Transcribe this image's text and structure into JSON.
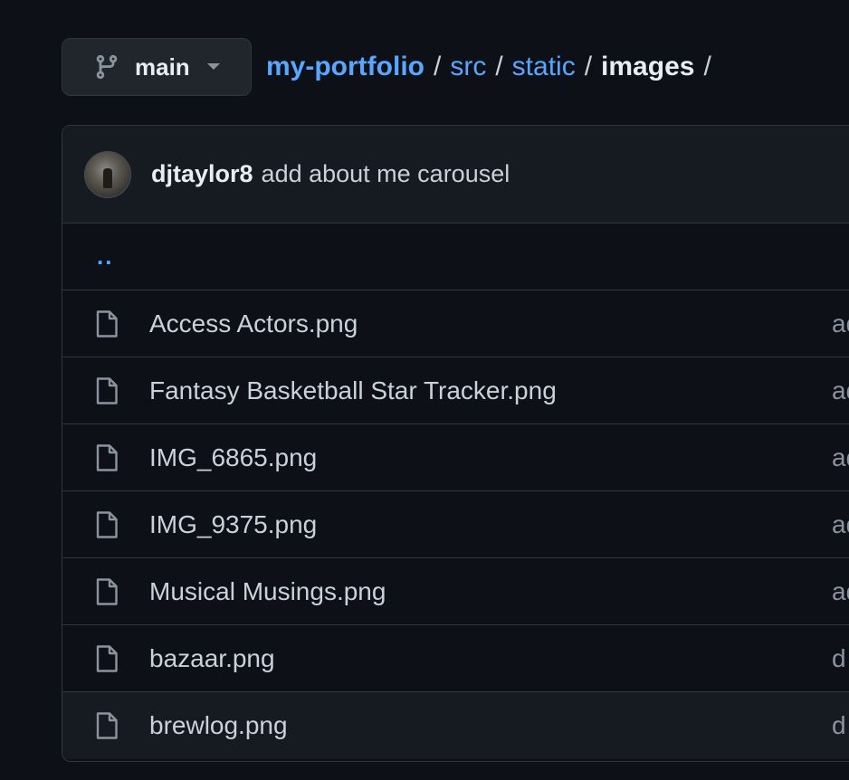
{
  "branch": {
    "name": "main",
    "icon": "git-branch-icon",
    "caret_icon": "caret-down-icon"
  },
  "breadcrumb": {
    "repo": "my-portfolio",
    "separator": "/",
    "segments": [
      "src",
      "static"
    ],
    "current": "images",
    "trailing": "/"
  },
  "latest_commit": {
    "author": "djtaylor8",
    "message": "add about me carousel"
  },
  "parent_link": "..",
  "files": [
    {
      "name": "Access Actors.png",
      "commit": "add"
    },
    {
      "name": "Fantasy Basketball Star Tracker.png",
      "commit": "add"
    },
    {
      "name": "IMG_6865.png",
      "commit": "add"
    },
    {
      "name": "IMG_9375.png",
      "commit": "add"
    },
    {
      "name": "Musical Musings.png",
      "commit": "add"
    },
    {
      "name": "bazaar.png",
      "commit": "d"
    },
    {
      "name": "brewlog.png",
      "commit": "d"
    }
  ],
  "colors": {
    "background": "#0d1117",
    "link": "#58a6ff",
    "border": "#30363d"
  }
}
